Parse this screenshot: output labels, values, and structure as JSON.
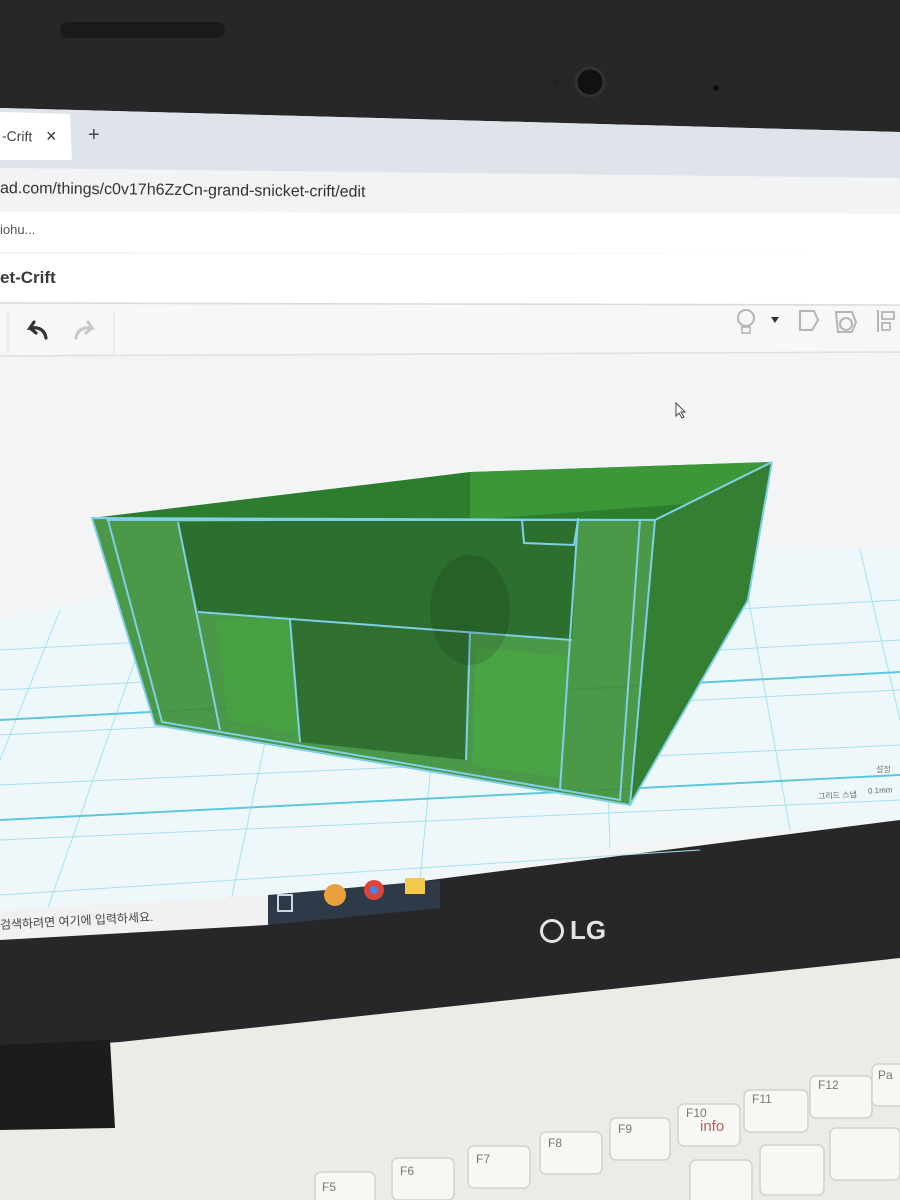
{
  "browser": {
    "tab_title": "-Crift",
    "tab_close": "×",
    "new_tab": "+",
    "url": "ad.com/things/c0v17h6ZzCn-grand-snicket-crift/edit",
    "bookmark": "iohu..."
  },
  "app": {
    "design_title": "et-Crift"
  },
  "workplane": {
    "grid_label": "그리드 스냅",
    "grid_value": "0.1mm",
    "edit_label": "설정"
  },
  "taskbar": {
    "search_placeholder": "검색하려면 여기에 입력하세요."
  },
  "laptop": {
    "brand": "LG"
  },
  "keyboard": {
    "keys": [
      "F5",
      "F6",
      "F7",
      "F8",
      "F9",
      "F10",
      "F11",
      "F12",
      "Pa"
    ],
    "f10_sub": "info"
  },
  "colors": {
    "screen_bg": "#f4f5f6",
    "grid_blue": "#7fd6ea",
    "model_green": "#2f8a2f",
    "bezel": "#262628"
  }
}
